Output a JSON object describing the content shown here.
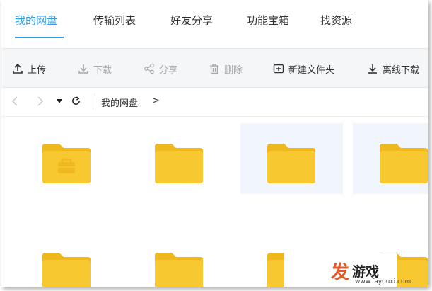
{
  "tabs": [
    {
      "label": "我的网盘",
      "active": true
    },
    {
      "label": "传输列表",
      "active": false
    },
    {
      "label": "好友分享",
      "active": false
    },
    {
      "label": "功能宝箱",
      "active": false
    },
    {
      "label": "找资源",
      "active": false
    }
  ],
  "toolbar": {
    "upload": "上传",
    "download": "下载",
    "share": "分享",
    "delete": "删除",
    "new_folder": "新建文件夹",
    "offline_download": "离线下载"
  },
  "address": {
    "breadcrumb": "我的网盘",
    "separator": ">"
  },
  "watermark": {
    "mark": "发",
    "name": "游戏",
    "url": "www.fayouxi.com"
  },
  "colors": {
    "accent": "#2ea0e8",
    "folder": "#f7c830",
    "folder_tab": "#efb81f",
    "disabled": "#a9a9a9",
    "watermark": "#e8572a"
  }
}
